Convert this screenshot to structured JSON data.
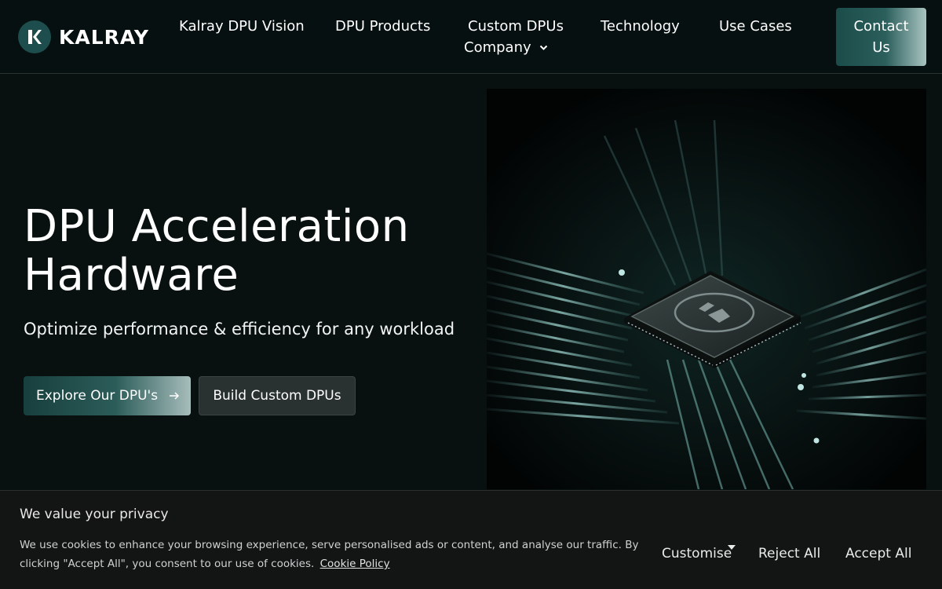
{
  "brand": {
    "name": "KALRAY",
    "mark_letter": "K"
  },
  "nav": {
    "items": [
      "Kalray DPU Vision",
      "DPU Products",
      "Custom DPUs",
      "Technology",
      "Use Cases",
      "Company"
    ],
    "contact_label": "Contact Us"
  },
  "hero": {
    "title": "DPU Acceleration Hardware",
    "subtitle": "Optimize performance & efficiency for any workload",
    "primary_cta": "Explore Our DPU's",
    "secondary_cta": "Build Custom DPUs"
  },
  "cookie": {
    "title": "We value your privacy",
    "text": "We use cookies to enhance your browsing experience, serve personalised ads or content, and analyse our traffic. By clicking \"Accept All\", you consent to our use of cookies.",
    "link": "Cookie Policy",
    "customise": "Customise",
    "reject": "Reject All",
    "accept": "Accept All"
  },
  "colors": {
    "background": "#081110",
    "accent": "#1d4d4c",
    "banner": "#131414"
  },
  "icons": [
    "kalray-logo-icon",
    "chevron-down-icon",
    "arrow-right-icon",
    "chip-k-logo-icon",
    "caret-down-icon"
  ]
}
